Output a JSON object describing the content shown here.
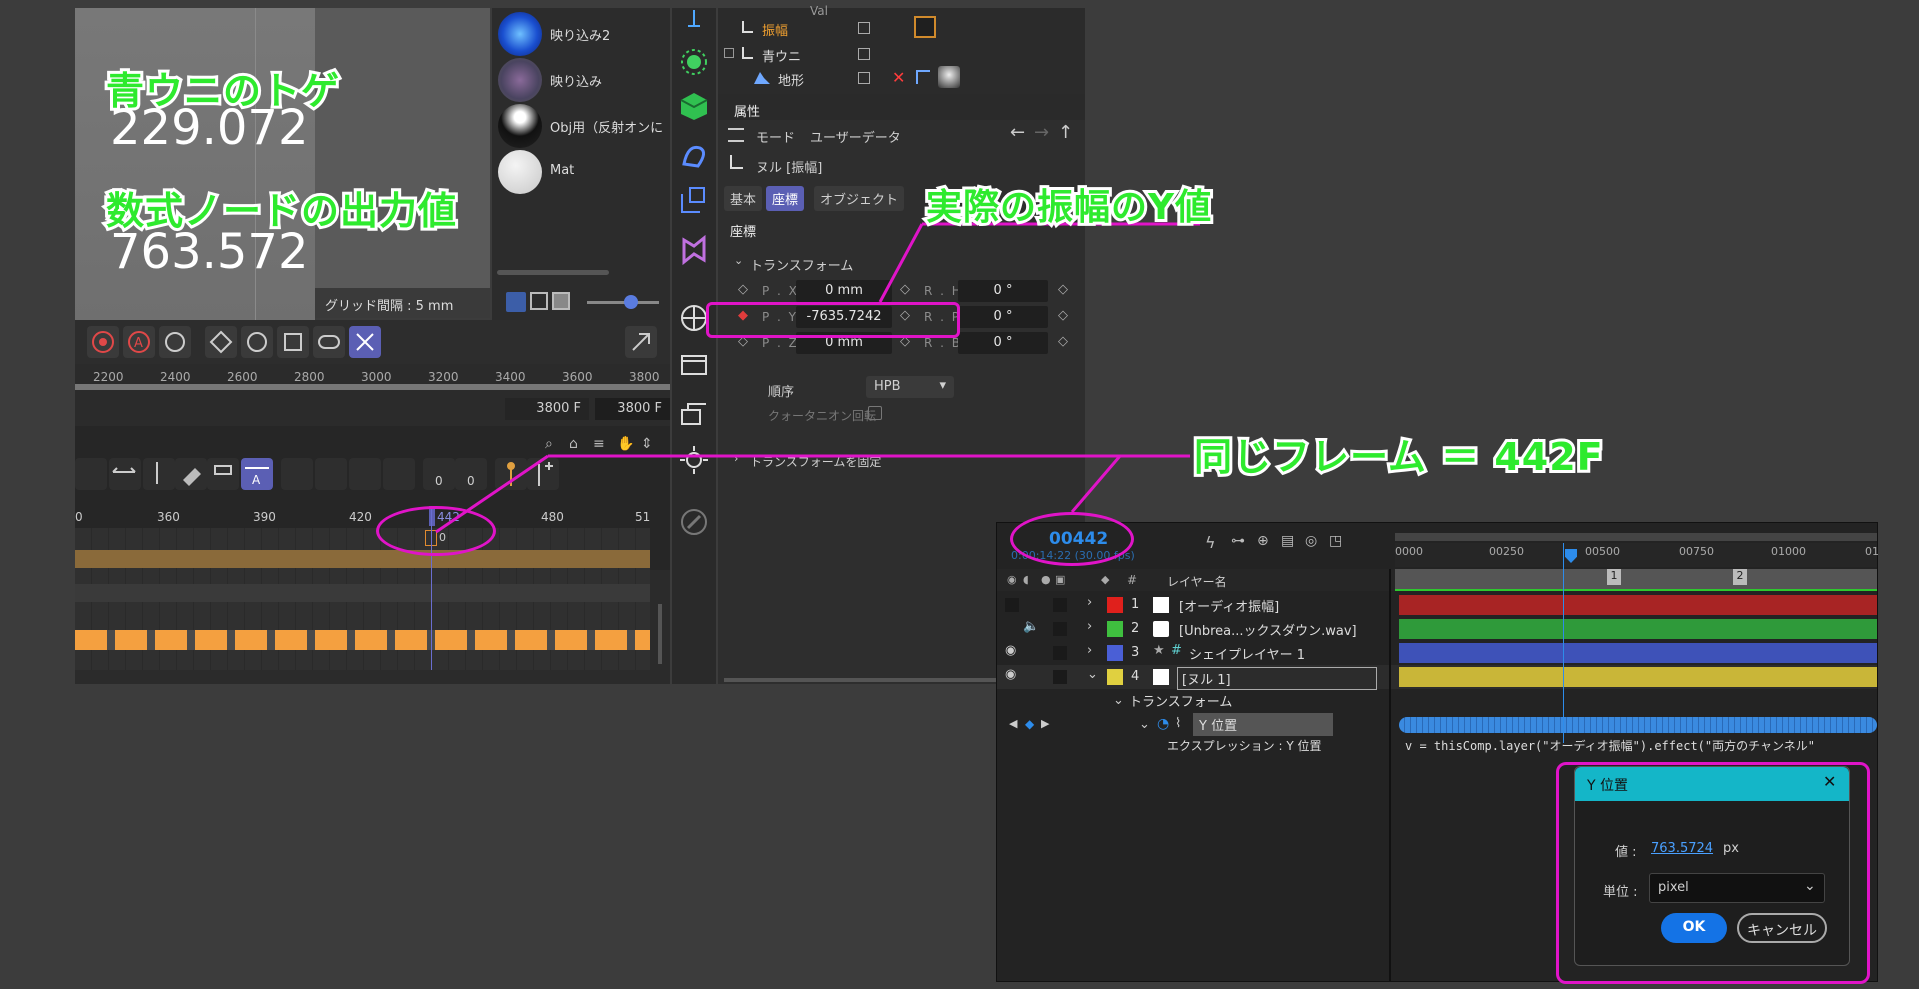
{
  "viewport": {
    "label_spikes": "青ウニのトゲ",
    "value_spikes": "229.072",
    "label_formula": "数式ノードの出力値",
    "value_formula": "763.572",
    "grid_spacing": "グリッド間隔 : 5 mm"
  },
  "materials": [
    {
      "name": "映り込み2"
    },
    {
      "name": "映り込み"
    },
    {
      "name": "Obj用（反射オンに"
    },
    {
      "name": "Mat"
    }
  ],
  "object_manager": {
    "rows": [
      "振幅",
      "青ウニ",
      "地形"
    ],
    "partial_top": "Val"
  },
  "attributes": {
    "header": "属性",
    "menu_mode": "モード",
    "menu_userdata": "ユーザーデータ",
    "object_name": "ヌル [振幅]",
    "tab_basic": "基本",
    "tab_coord": "座標",
    "tab_object": "オブジェクト",
    "section": "座標",
    "group_transform": "トランスフォーム",
    "px_label": "P . X",
    "px_value": "0 mm",
    "py_label": "P . Y",
    "py_value": "-7635.7242",
    "pz_label": "P . Z",
    "pz_value": "0 mm",
    "rh_label": "R . H",
    "rh_value": "0 °",
    "rp_label": "R . P",
    "rp_value": "0 °",
    "rb_label": "R . B",
    "rb_value": "0 °",
    "order_label": "順序",
    "order_value": "HPB",
    "quat_label": "クォータニオン回転",
    "freeze_label": "トランスフォームを固定"
  },
  "annotations": {
    "actual_y": "実際の振幅のY値",
    "same_frame": "同じフレーム ＝ 442F"
  },
  "c4d_timeline": {
    "ruler_top": [
      "2200",
      "2400",
      "2600",
      "2800",
      "3000",
      "3200",
      "3400",
      "3600",
      "3800"
    ],
    "frame_end_1": "3800 F",
    "frame_end_2": "3800 F",
    "ruler_bottom": [
      "0",
      "360",
      "390",
      "420",
      "442",
      "480",
      "51"
    ],
    "key_value": "0",
    "btn_count_1": "0",
    "btn_count_2": "0"
  },
  "ae": {
    "timecode": "00442",
    "timecode_sub": "0:00:14:22 (30.00 fps)",
    "ruler": [
      "0000",
      "00250",
      "00500",
      "00750",
      "01000",
      "01"
    ],
    "col_hash": "#",
    "col_layername": "レイヤー名",
    "markers": [
      "1",
      "2"
    ],
    "layers": [
      {
        "num": "1",
        "name": "[オーディオ振幅]",
        "color": "#e0201c"
      },
      {
        "num": "2",
        "name": "[Unbrea...ックスダウン.wav]",
        "color": "#3fbf3f"
      },
      {
        "num": "3",
        "name": "シェイプレイヤー 1",
        "color": "#4a5fd6"
      },
      {
        "num": "4",
        "name": "[ヌル 1]",
        "color": "#e0d040"
      }
    ],
    "transform": "トランスフォーム",
    "prop_y": "Y 位置",
    "expr_label": "エクスプレッション : Y 位置",
    "expression": "v = thisComp.layer(\"オーディオ振幅\").effect(\"両方のチャンネル\""
  },
  "dialog": {
    "title": "Y 位置",
    "value_label": "値 :",
    "value": "763.5724",
    "value_unit": "px",
    "unit_label": "単位 :",
    "unit_value": "pixel",
    "ok": "OK",
    "cancel": "キャンセル"
  },
  "colors": {
    "accent_pink": "#e014c8",
    "ae_blue": "#2d8ceb",
    "c4d_selection": "#5b5fb4",
    "annotation_green": "#2eea2e"
  }
}
